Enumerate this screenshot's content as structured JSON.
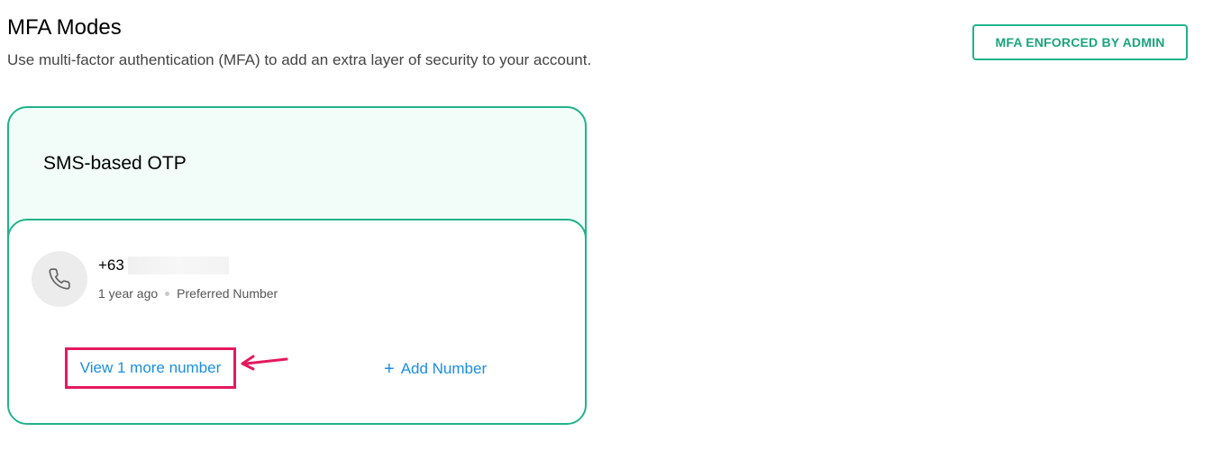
{
  "header": {
    "title": "MFA Modes",
    "subtitle": "Use multi-factor authentication (MFA) to add an extra layer of security to your account.",
    "badge": "MFA ENFORCED BY ADMIN"
  },
  "card": {
    "title": "SMS-based OTP",
    "phone": {
      "prefix": "+63",
      "added": "1 year ago",
      "label": "Preferred Number",
      "icon": "phone-icon"
    },
    "view_more_label": "View 1 more number",
    "add_number_label": "Add Number",
    "add_icon": "plus-icon"
  },
  "colors": {
    "accent_green": "#1fb38a",
    "link_blue": "#1a8fe0",
    "annotation_pink": "#e5195e",
    "card_bg": "#f2fdf9"
  }
}
